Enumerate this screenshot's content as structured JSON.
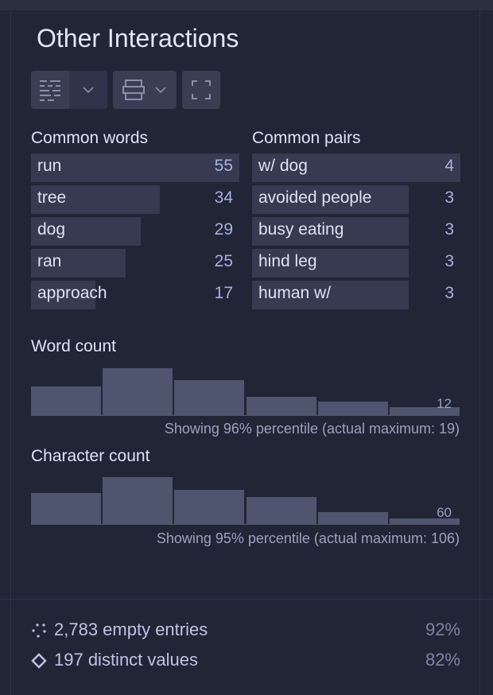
{
  "panel": {
    "title": "Other Interactions",
    "toolbar": {
      "icons": [
        "text-lines-icon",
        "chevron-down-icon",
        "rows-icon",
        "chevron-down-icon",
        "fullscreen-icon"
      ]
    },
    "common_words": {
      "label": "Common words",
      "items": [
        {
          "word": "run",
          "count": "55",
          "value": 55
        },
        {
          "word": "tree",
          "count": "34",
          "value": 34
        },
        {
          "word": "dog",
          "count": "29",
          "value": 29
        },
        {
          "word": "ran",
          "count": "25",
          "value": 25
        },
        {
          "word": "approach",
          "count": "17",
          "value": 17
        }
      ]
    },
    "common_pairs": {
      "label": "Common pairs",
      "items": [
        {
          "word": "w/ dog",
          "count": "4",
          "value": 4
        },
        {
          "word": "avoided people",
          "count": "3",
          "value": 3
        },
        {
          "word": "busy eating",
          "count": "3",
          "value": 3
        },
        {
          "word": "hind leg",
          "count": "3",
          "value": 3
        },
        {
          "word": "human w/",
          "count": "3",
          "value": 3
        }
      ]
    },
    "word_count": {
      "label": "Word count",
      "max_label": "12",
      "note": "Showing 96% percentile (actual maximum: 19)"
    },
    "char_count": {
      "label": "Character count",
      "max_label": "60",
      "note": "Showing 95% percentile (actual maximum: 106)"
    },
    "stats": [
      {
        "icon": "empty-dots-icon",
        "text": "2,783 empty entries",
        "percent": "92%"
      },
      {
        "icon": "diamond-icon",
        "text": "197 distinct values",
        "percent": "82%"
      }
    ]
  },
  "chart_data": [
    {
      "type": "bar",
      "title": "Word count",
      "categories": [
        "bin1",
        "bin2",
        "bin3",
        "bin4",
        "bin5",
        "bin6"
      ],
      "values": [
        36,
        59,
        44,
        23,
        17,
        10
      ],
      "xlabel": "",
      "ylabel": "",
      "x_max_label": "12",
      "note": "Showing 96% percentile (actual maximum: 19)"
    },
    {
      "type": "bar",
      "title": "Character count",
      "categories": [
        "bin1",
        "bin2",
        "bin3",
        "bin4",
        "bin5",
        "bin6"
      ],
      "values": [
        39,
        59,
        43,
        34,
        15,
        7
      ],
      "xlabel": "",
      "ylabel": "",
      "x_max_label": "60",
      "note": "Showing 95% percentile (actual maximum: 106)"
    }
  ]
}
